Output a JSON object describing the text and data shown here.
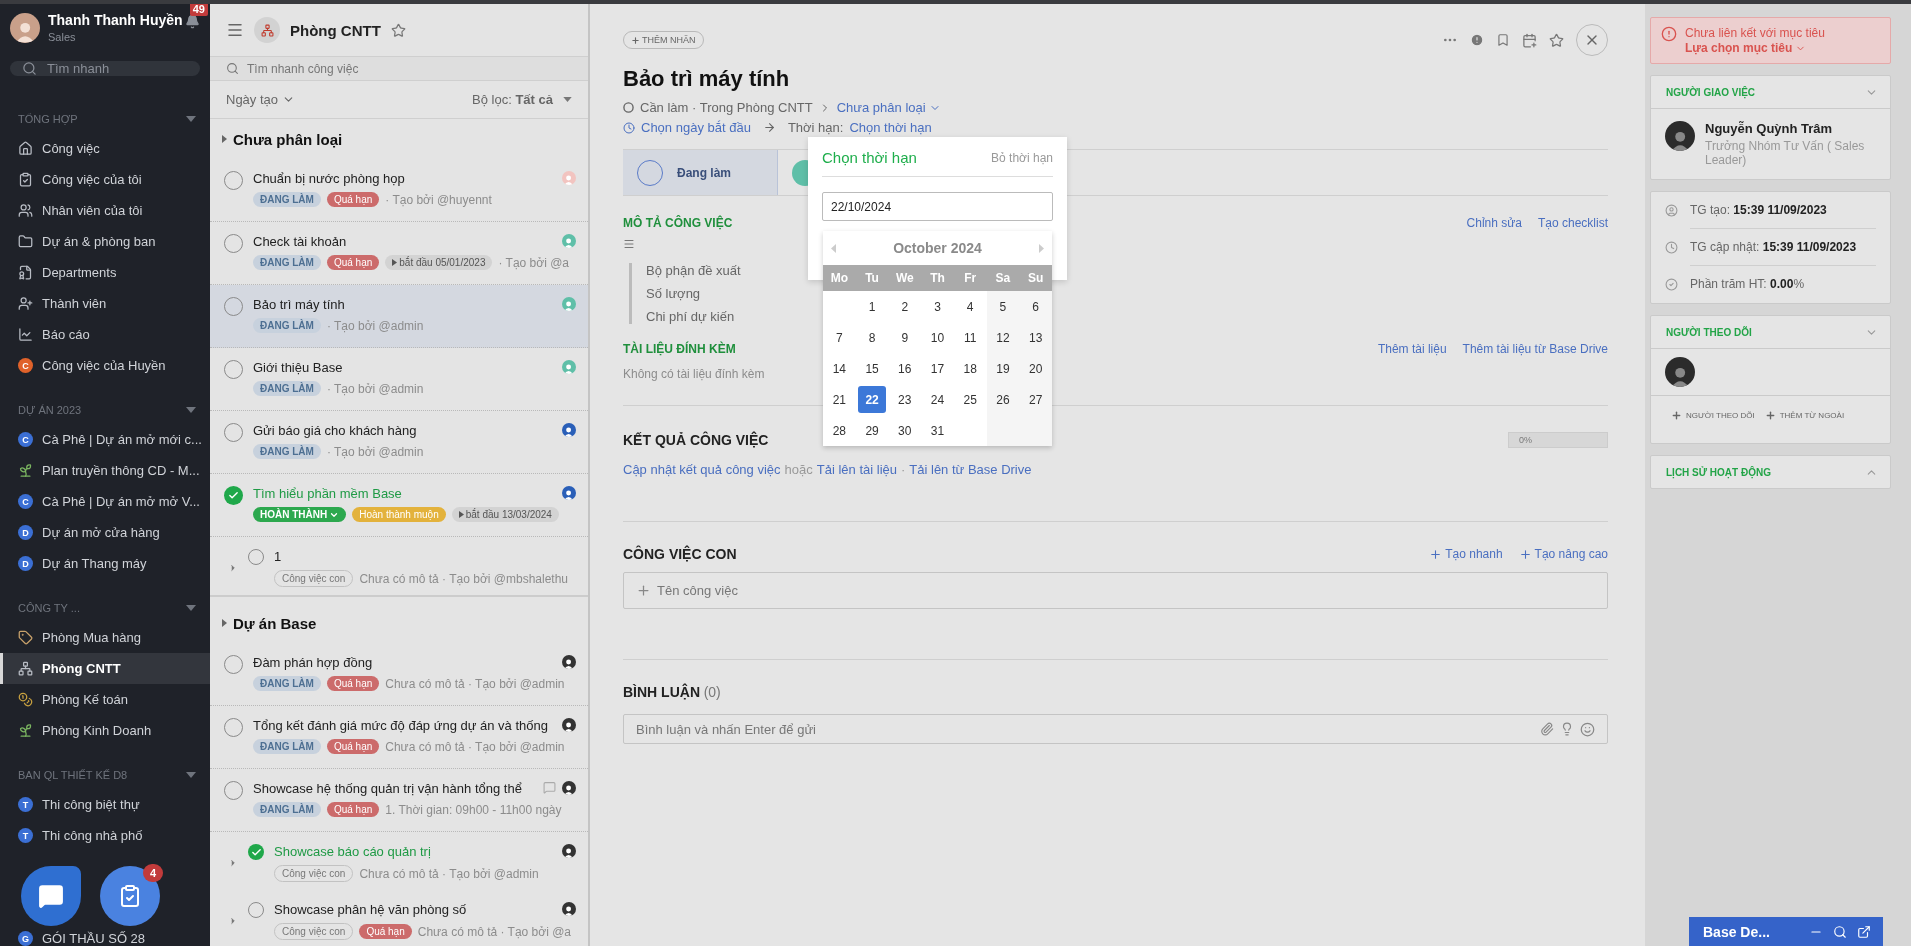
{
  "user": {
    "name": "Thanh Thanh Huyền",
    "role": "Sales",
    "notifications": "49"
  },
  "sidebar": {
    "search_placeholder": "Tìm nhanh",
    "sections": [
      {
        "title": "TỔNG HỢP",
        "items": [
          {
            "label": "Công việc",
            "kind": "home",
            "selected": false
          },
          {
            "label": "Công việc của tôi",
            "kind": "clipboard",
            "selected": false
          },
          {
            "label": "Nhân viên của tôi",
            "kind": "users",
            "selected": false
          },
          {
            "label": "Dự án & phòng ban",
            "kind": "folder",
            "selected": false
          },
          {
            "label": "Departments",
            "kind": "departments",
            "selected": false
          },
          {
            "label": "Thành viên",
            "kind": "members",
            "selected": false
          },
          {
            "label": "Báo cáo",
            "kind": "chart",
            "selected": false
          },
          {
            "label": "Công việc của Huyền",
            "kind": "letter",
            "letter": "C",
            "color": "#e0622a",
            "selected": false
          }
        ]
      },
      {
        "title": "DỰ ÁN 2023",
        "items": [
          {
            "label": "Cà Phê | Dự án mở mới c...",
            "kind": "letter",
            "letter": "C",
            "color": "#3b6fd4",
            "selected": false
          },
          {
            "label": "Plan truyền thông CD - M...",
            "kind": "sprout",
            "selected": false
          },
          {
            "label": "Cà Phê | Dự án mở mở V...",
            "kind": "letter",
            "letter": "C",
            "color": "#3b6fd4",
            "selected": false
          },
          {
            "label": "Dự án mở cửa hàng",
            "kind": "letter",
            "letter": "D",
            "color": "#3b6fd4",
            "selected": false
          },
          {
            "label": "Dự án Thang máy",
            "kind": "letter",
            "letter": "D",
            "color": "#3b6fd4",
            "selected": false
          }
        ]
      },
      {
        "title": "CÔNG TY ...",
        "items": [
          {
            "label": "Phòng Mua hàng",
            "kind": "tag",
            "selected": false
          },
          {
            "label": "Phòng CNTT",
            "kind": "org",
            "selected": true
          },
          {
            "label": "Phòng Kế toán",
            "kind": "coins",
            "selected": false
          },
          {
            "label": "Phòng Kinh Doanh",
            "kind": "sprout",
            "selected": false
          }
        ]
      },
      {
        "title": "BAN QL THIẾT KẾ D8",
        "items": [
          {
            "label": "Thi công biệt thự",
            "kind": "letter",
            "letter": "T",
            "color": "#3b6fd4",
            "selected": false
          },
          {
            "label": "Thi công nhà phố",
            "kind": "letter",
            "letter": "T",
            "color": "#3b6fd4",
            "selected": false
          }
        ]
      },
      {
        "items": [
          {
            "label": "GÓI THẦU SỐ 28",
            "kind": "letter",
            "letter": "G",
            "color": "#3b6fd4",
            "selected": false
          }
        ]
      }
    ]
  },
  "floating": {
    "task_badge": "4"
  },
  "tasklist": {
    "title": "Phòng CNTT",
    "search_placeholder": "Tìm nhanh công việc",
    "sort": "Ngày tạo",
    "filter": "Bộ lọc: **Tất cả**",
    "groups": [
      {
        "title": "Chưa phân loại",
        "tasks": [
          {
            "title": "Chuẩn bị nước phòng họp",
            "done": false,
            "selected": false,
            "subtask": false,
            "color": "#f2c4c0",
            "tags": [
              {
                "kind": "status",
                "text": "ĐANG LÀM"
              },
              {
                "kind": "overdue",
                "text": "Quá hạn"
              }
            ],
            "meta": "· Tạo bởi @huyennt"
          },
          {
            "title": "Check tài khoản",
            "done": false,
            "selected": false,
            "subtask": false,
            "color": "#5fbfa8",
            "tags": [
              {
                "kind": "status",
                "text": "ĐANG LÀM"
              },
              {
                "kind": "overdue",
                "text": "Quá hạn"
              },
              {
                "kind": "date",
                "text": "bắt đầu 05/01/2023"
              }
            ],
            "meta": "· Tạo bởi @a"
          },
          {
            "title": "Bảo trì máy tính",
            "done": false,
            "selected": true,
            "subtask": false,
            "color": "#5fbfa8",
            "tags": [
              {
                "kind": "status",
                "text": "ĐANG LÀM"
              }
            ],
            "meta": "· Tạo bởi @admin"
          },
          {
            "title": "Giới thiệu Base",
            "done": false,
            "selected": false,
            "subtask": false,
            "color": "#5fbfa8",
            "tags": [
              {
                "kind": "status",
                "text": "ĐANG LÀM"
              }
            ],
            "meta": "· Tạo bởi @admin"
          },
          {
            "title": "Gửi báo giá cho khách hàng",
            "done": false,
            "selected": false,
            "subtask": false,
            "color": "#2a5fb8",
            "tags": [
              {
                "kind": "status",
                "text": "ĐANG LÀM"
              }
            ],
            "meta": "· Tạo bởi @admin"
          },
          {
            "title": "Tìm hiểu phần mềm Base",
            "done": true,
            "selected": false,
            "subtask": false,
            "color": "#2a5fb8",
            "tags": [
              {
                "kind": "done",
                "text": "HOÀN THÀNH"
              },
              {
                "kind": "late",
                "text": "Hoàn thành muộn"
              },
              {
                "kind": "date",
                "text": "bắt đầu 13/03/2024"
              }
            ]
          },
          {
            "title": "1",
            "done": false,
            "selected": false,
            "subtask": true,
            "tags": [
              {
                "kind": "sub",
                "text": "Công việc con"
              }
            ],
            "meta": "Chưa có mô tả · Tạo bởi @mbshalethu"
          }
        ]
      },
      {
        "title": "Dự án Base",
        "tasks": [
          {
            "title": "Đàm phán hợp đồng",
            "done": false,
            "selected": false,
            "subtask": false,
            "color": "#333333",
            "tags": [
              {
                "kind": "status",
                "text": "ĐANG LÀM"
              },
              {
                "kind": "overdue",
                "text": "Quá hạn"
              }
            ],
            "meta": "Chưa có mô tả · Tạo bởi @admin"
          },
          {
            "title": "Tổng kết đánh giá mức độ đáp ứng dự án và thống",
            "done": false,
            "selected": false,
            "subtask": false,
            "color": "#333333",
            "tags": [
              {
                "kind": "status",
                "text": "ĐANG LÀM"
              },
              {
                "kind": "overdue",
                "text": "Quá hạn"
              }
            ],
            "meta": "Chưa có mô tả · Tạo bởi @admin"
          },
          {
            "title": "Showcase hệ thống quản trị vận hành tổng thể",
            "done": false,
            "selected": false,
            "subtask": false,
            "color": "#333333",
            "comment": true,
            "tags": [
              {
                "kind": "status",
                "text": "ĐANG LÀM"
              },
              {
                "kind": "overdue",
                "text": "Quá hạn"
              }
            ],
            "meta": "1. Thời gian: 09h00 - 11h00 ngày"
          },
          {
            "title": "Showcase báo cáo quản trị",
            "done": true,
            "selected": false,
            "subtask": true,
            "color": "#333333",
            "tags": [
              {
                "kind": "sub",
                "text": "Công việc con"
              }
            ],
            "meta": "Chưa có mô tả · Tạo bởi @admin"
          },
          {
            "title": "Showcase phân hệ văn phòng số",
            "done": false,
            "selected": false,
            "subtask": true,
            "color": "#333333",
            "tags": [
              {
                "kind": "sub",
                "text": "Công việc con"
              },
              {
                "kind": "overdue",
                "text": "Quá hạn"
              }
            ],
            "meta": "Chưa có mô tả · Tạo bởi @a"
          }
        ]
      }
    ]
  },
  "task": {
    "add_label": "THÊM NHÃN",
    "title": "Bảo trì máy tính",
    "breadcrumb": "Cần làm · Trong Phòng CNTT",
    "category": "Chưa phân loại",
    "start": "Chọn ngày bắt đầu",
    "deadline_label": "Thời hạn:",
    "deadline": "Chọn thời hạn",
    "steps": [
      {
        "label": "Đang làm",
        "selected": true
      },
      {
        "selected": false
      }
    ],
    "description": {
      "title": "MÔ TẢ CÔNG VIỆC",
      "actions": [
        "Chỉnh sửa",
        "Tạo checklist"
      ],
      "lines": [
        "Bộ phận đề xuất",
        "Số lượng",
        "Chi phí dự kiến"
      ]
    },
    "attachments": {
      "title": "TÀI LIỆU ĐÍNH KÈM",
      "actions": [
        "Thêm tài liệu",
        "Thêm tài liệu từ Base Drive"
      ],
      "empty": "Không có tài liệu đính kèm"
    },
    "result": {
      "title": "KẾT QUẢ CÔNG VIỆC",
      "progress": "0%",
      "level": 0,
      "parts": [
        {
          "kind": "link",
          "text": "Cập nhật kết quả công việc"
        },
        {
          "kind": "text",
          "text": "hoặc"
        },
        {
          "kind": "link",
          "text": "Tải lên tài liệu"
        },
        {
          "kind": "text",
          "text": "·"
        },
        {
          "kind": "link",
          "text": "Tải lên từ Base Drive"
        }
      ]
    },
    "subtasks": {
      "title": "CÔNG VIỆC CON",
      "actions": [
        "Tạo nhanh",
        "Tạo nâng cao"
      ],
      "placeholder": "Tên công việc"
    },
    "comments": {
      "title": "BÌNH LUẬN",
      "count": "(0)",
      "placeholder": "Bình luận và nhấn Enter để gửi"
    }
  },
  "datepicker": {
    "title": "Chọn thời hạn",
    "clear": "Bỏ thời hạn",
    "value": "22/10/2024",
    "month": "October 2024",
    "weekdays": [
      "Mo",
      "Tu",
      "We",
      "Th",
      "Fr",
      "Sa",
      "Su"
    ],
    "weeks": [
      [
        {
          "day": "1",
          "selected": false
        },
        {
          "day": "2",
          "selected": false
        },
        {
          "day": "3",
          "selected": false
        },
        {
          "day": "4",
          "selected": false
        },
        {
          "day": "5",
          "selected": false
        },
        {
          "day": "6",
          "selected": false
        }
      ],
      [
        {
          "day": "7",
          "selected": false
        },
        {
          "day": "8",
          "selected": false
        },
        {
          "day": "9",
          "selected": false
        },
        {
          "day": "10",
          "selected": false
        },
        {
          "day": "11",
          "selected": false
        },
        {
          "day": "12",
          "selected": false
        },
        {
          "day": "13",
          "selected": false
        }
      ],
      [
        {
          "day": "14",
          "selected": false
        },
        {
          "day": "15",
          "selected": false
        },
        {
          "day": "16",
          "selected": false
        },
        {
          "day": "17",
          "selected": false
        },
        {
          "day": "18",
          "selected": false
        },
        {
          "day": "19",
          "selected": false
        },
        {
          "day": "20",
          "selected": false
        }
      ],
      [
        {
          "day": "21",
          "selected": false
        },
        {
          "day": "22",
          "selected": true
        },
        {
          "day": "23",
          "selected": false
        },
        {
          "day": "24",
          "selected": false
        },
        {
          "day": "25",
          "selected": false
        },
        {
          "day": "26",
          "selected": false
        },
        {
          "day": "27",
          "selected": false
        }
      ],
      [
        {
          "day": "28",
          "selected": false
        },
        {
          "day": "29",
          "selected": false
        },
        {
          "day": "30",
          "selected": false
        },
        {
          "day": "31",
          "selected": false
        }
      ]
    ]
  },
  "right": {
    "alert": {
      "text": "Chưa liên kết với mục tiêu",
      "action": "Lựa chọn mục tiêu"
    },
    "assigner": {
      "title": "NGƯỜI GIAO VIỆC",
      "expanded": true,
      "name": "Nguyễn Quỳnh Trâm",
      "role": "Trưởng Nhóm Tư Vấn ( Sales Leader)"
    },
    "info": [
      {
        "kind": "user",
        "text": "TG tạo: **15:39 11/09/2023**"
      },
      {
        "kind": "clock",
        "text": "TG cập nhật: **15:39 11/09/2023**"
      },
      {
        "kind": "check",
        "text": "Phần trăm HT: **0.00**%"
      }
    ],
    "followers": {
      "title": "NGƯỜI THEO DÕI",
      "expanded": true,
      "actions": [
        "NGƯỜI THEO DÕI",
        "THÊM TỪ NGOÀI"
      ]
    },
    "history": {
      "title": "LỊCH SỬ HOẠT ĐỘNG",
      "expanded": false
    }
  },
  "chat": {
    "title": "Base De..."
  }
}
